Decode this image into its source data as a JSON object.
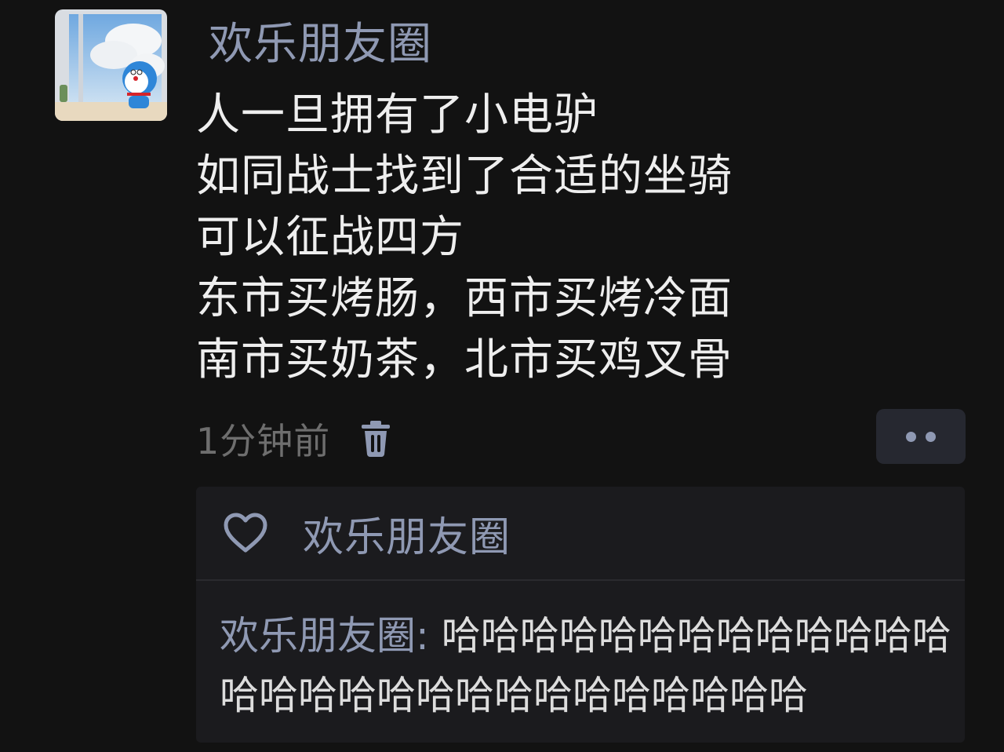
{
  "post": {
    "author": "欢乐朋友圈",
    "lines": [
      "人一旦拥有了小电驴",
      "如同战士找到了合适的坐骑",
      "可以征战四方",
      "东市买烤肠，西市买烤冷面",
      "南市买奶茶，北市买鸡叉骨"
    ],
    "timestamp": "1分钟前"
  },
  "interactions": {
    "likes": [
      "欢乐朋友圈"
    ],
    "comments": [
      {
        "author": "欢乐朋友圈",
        "separator": ": ",
        "text": "哈哈哈哈哈哈哈哈哈哈哈哈哈哈哈哈哈哈哈哈哈哈哈哈哈哈哈哈"
      }
    ]
  },
  "icons": {
    "avatar": "doraemon-window-avatar",
    "delete": "trash-icon",
    "more": "more-dots-icon",
    "like": "heart-icon"
  },
  "colors": {
    "background": "#121212",
    "name": "#8f99b3",
    "text": "#eeeeee",
    "muted": "#6e6e6e",
    "panel": "#1b1b1e"
  }
}
